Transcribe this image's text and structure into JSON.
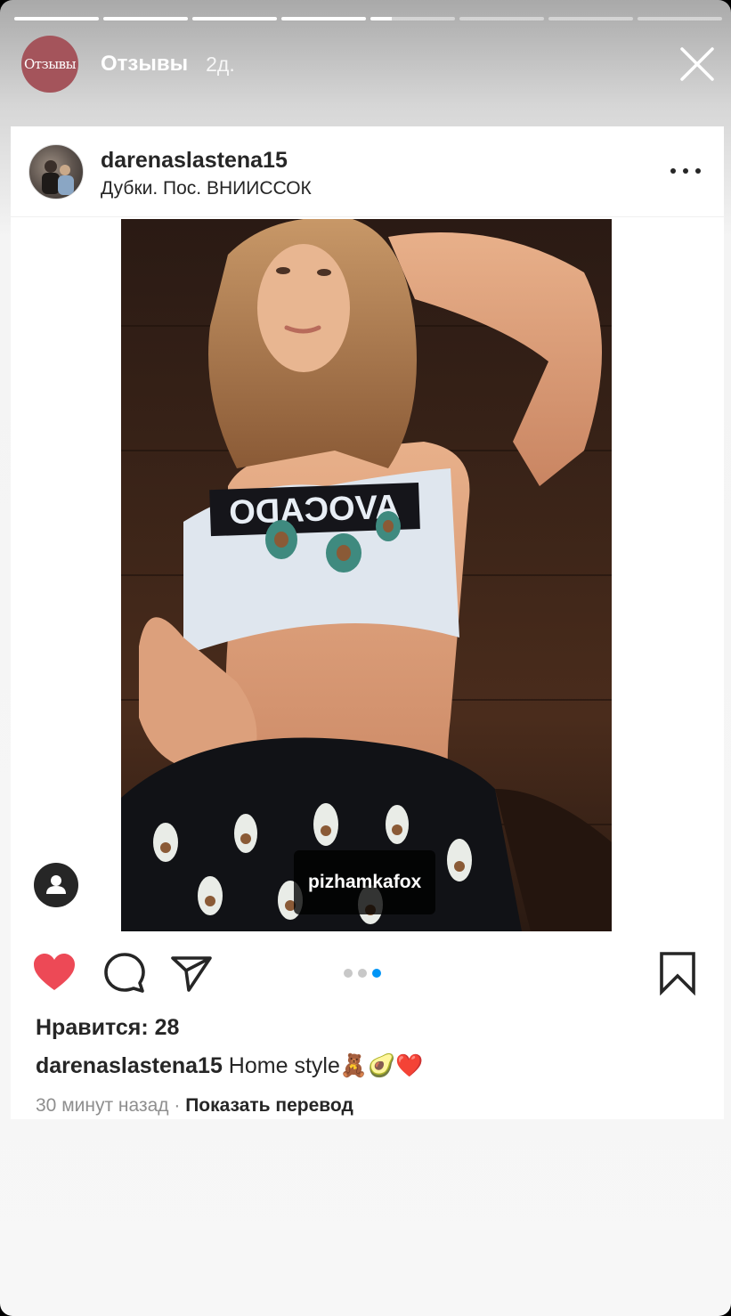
{
  "story": {
    "progress": [
      1,
      1,
      1,
      1,
      0.25,
      0,
      0,
      0
    ],
    "avatar_text": "Отзывы",
    "title": "Отзывы",
    "time": "2д."
  },
  "post": {
    "username": "darenaslastena15",
    "location": "Дубки. Пос. ВНИИССОК",
    "photo_text": "AVOCADO",
    "tag_label": "pizhamkafox",
    "carousel": {
      "count": 3,
      "active": 3
    },
    "likes": "Нравится: 28",
    "caption_user": "darenaslastena15",
    "caption_text": " Home style🧸🥑❤️",
    "time_ago": "30 минут назад",
    "separator": " · ",
    "translate": "Показать перевод"
  },
  "colors": {
    "like": "#ed4956",
    "story_avatar": "#a4545b",
    "carousel_active": "#0095f6"
  },
  "icons": [
    "close-icon",
    "more-icon",
    "user-icon",
    "heart-icon",
    "comment-icon",
    "share-icon",
    "bookmark-icon"
  ]
}
